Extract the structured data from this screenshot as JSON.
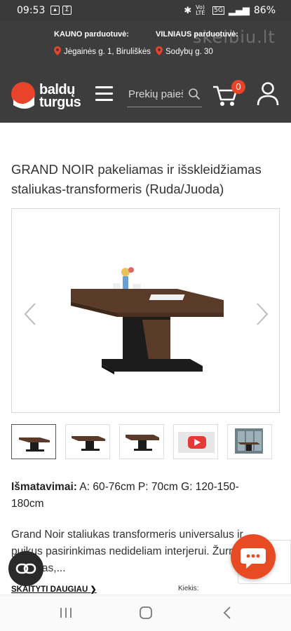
{
  "status_bar": {
    "time": "09:53",
    "network": "Vo) LTE",
    "signal_badge": "5G",
    "battery": "86%"
  },
  "header": {
    "watermark": "skelbiu.lt",
    "stores": [
      {
        "name": "KAUNO parduotuvė:",
        "address": "Jėgainės g. 1, Biruliškės"
      },
      {
        "name": "VILNIAUS parduotuvė:",
        "address": "Sodybų g. 30"
      }
    ],
    "logo": {
      "line1": "baldų",
      "line2": "turgus"
    },
    "search": {
      "placeholder": "Prekių paieška"
    },
    "cart": {
      "count": "0"
    }
  },
  "product": {
    "title": "GRAND NOIR pakeliamas ir išskleidžiamas staliukas-transformeris (Ruda/Juoda)",
    "dimensions_label": "Išmatavimai:",
    "dimensions_value": " A: 60-76cm P: 70cm G: 120-150-180cm",
    "description": "Grand Noir staliukas transformeris universalus ir puikus pasirinkimas nedideliam interjerui. Žurnalinis staliukas,...",
    "read_more": "SKAITYTI DAUGIAU",
    "quantity_label": "Kiekis:"
  },
  "colors": {
    "header_bg": "#3d3d3d",
    "accent": "#e8432b",
    "wood": "#5a3b2a",
    "black": "#1c1c1c"
  }
}
